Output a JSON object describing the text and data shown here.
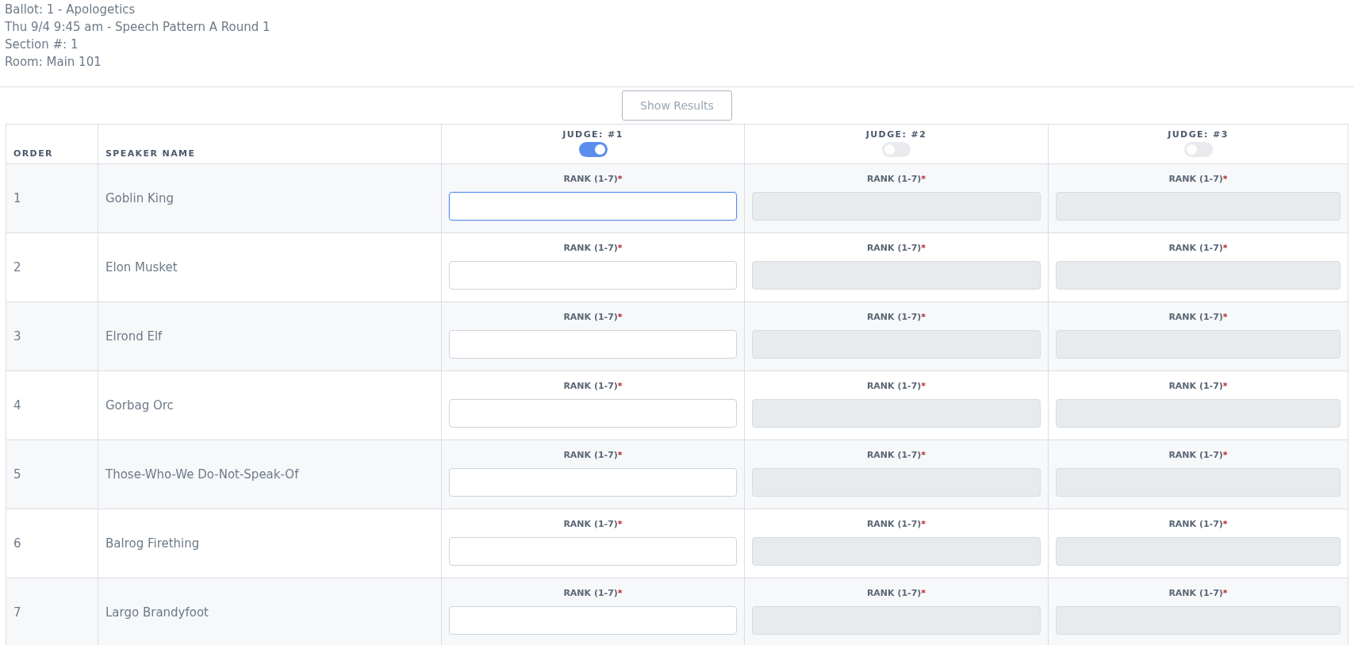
{
  "ballot_info": [
    "Ballot: 1 - Apologetics",
    "Thu 9/4 9:45 am - Speech Pattern A Round 1",
    "Section #: 1",
    "Room: Main 101"
  ],
  "show_results_button": "Show Results",
  "table": {
    "columns": [
      "ORDER",
      "SPEAKER NAME"
    ],
    "judges": [
      {
        "label": "JUDGE: #1",
        "on": true
      },
      {
        "label": "JUDGE: #2",
        "on": false
      },
      {
        "label": "JUDGE: #3",
        "on": false
      }
    ],
    "rows": [
      {
        "order": "1",
        "name": "Goblin King",
        "ranks": [
          {
            "label": "RANK (1-7)",
            "mark": "*",
            "focused": true
          },
          {
            "label": "RANK (1-7)",
            "mark": "*",
            "focused": false
          },
          {
            "label": "RANK (1-7)",
            "mark": "*",
            "focused": false
          }
        ]
      },
      {
        "order": "2",
        "name": "Elon Musket",
        "ranks": [
          {
            "label": "RANK (1-7)",
            "mark": "*",
            "focused": false
          },
          {
            "label": "RANK (1-7)",
            "mark": "*",
            "focused": false
          },
          {
            "label": "RANK (1-7)",
            "mark": "*",
            "focused": false
          }
        ]
      },
      {
        "order": "3",
        "name": "Elrond Elf",
        "ranks": [
          {
            "label": "RANK (1-7)",
            "mark": "*",
            "focused": false
          },
          {
            "label": "RANK (1-7)",
            "mark": "*",
            "focused": false
          },
          {
            "label": "RANK (1-7)",
            "mark": "*",
            "focused": false
          }
        ]
      },
      {
        "order": "4",
        "name": "Gorbag Orc",
        "ranks": [
          {
            "label": "RANK (1-7)",
            "mark": "*",
            "focused": false
          },
          {
            "label": "RANK (1-7)",
            "mark": "*",
            "focused": false
          },
          {
            "label": "RANK (1-7)",
            "mark": "*",
            "focused": false
          }
        ]
      },
      {
        "order": "5",
        "name": "Those-Who-We Do-Not-Speak-Of",
        "ranks": [
          {
            "label": "RANK (1-7)",
            "mark": "*",
            "focused": false
          },
          {
            "label": "RANK (1-7)",
            "mark": "*",
            "focused": false
          },
          {
            "label": "RANK (1-7)",
            "mark": "*",
            "focused": false
          }
        ]
      },
      {
        "order": "6",
        "name": "Balrog Firething",
        "ranks": [
          {
            "label": "RANK (1-7)",
            "mark": "*",
            "focused": false
          },
          {
            "label": "RANK (1-7)",
            "mark": "*",
            "focused": false
          },
          {
            "label": "RANK (1-7)",
            "mark": "*",
            "focused": false
          }
        ]
      },
      {
        "order": "7",
        "name": "Largo Brandyfoot",
        "ranks": [
          {
            "label": "RANK (1-7)",
            "mark": "*",
            "focused": false
          },
          {
            "label": "RANK (1-7)",
            "mark": "*",
            "focused": false
          },
          {
            "label": "RANK (1-7)",
            "mark": "*",
            "focused": false
          }
        ]
      }
    ]
  }
}
